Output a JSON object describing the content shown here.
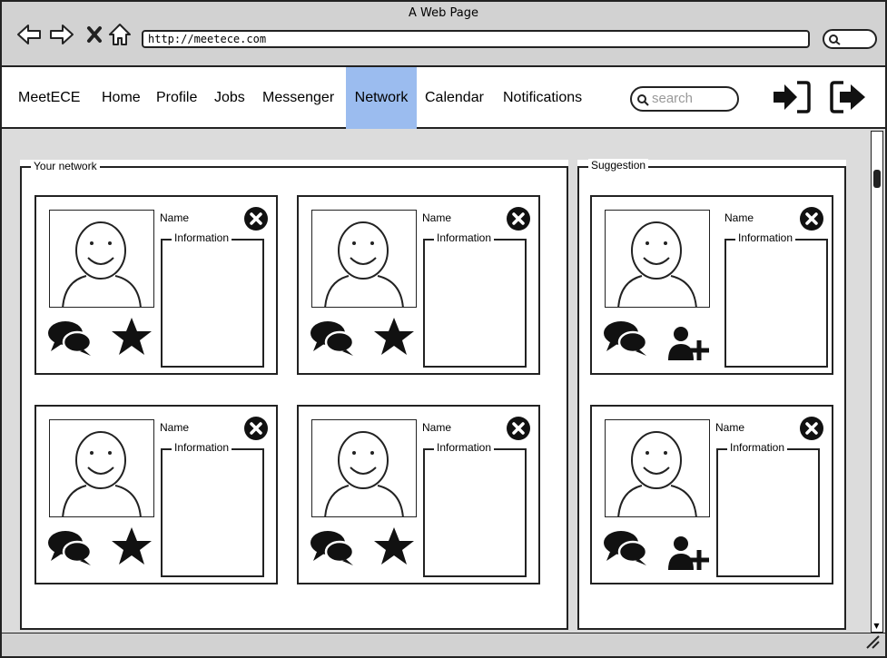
{
  "browser": {
    "title": "A Web Page",
    "url": "http://meetece.com"
  },
  "nav": {
    "brand": "MeetECE",
    "items": [
      {
        "label": "Home"
      },
      {
        "label": "Profile"
      },
      {
        "label": "Jobs"
      },
      {
        "label": "Messenger"
      },
      {
        "label": "Network",
        "active": true
      },
      {
        "label": "Calendar"
      },
      {
        "label": "Notifications"
      }
    ],
    "search_placeholder": "search",
    "active_color": "#9bbcef"
  },
  "network_panel": {
    "title": "Your network",
    "cards": [
      {
        "name": "Name",
        "info_label": "Information",
        "actions": [
          "chat-icon",
          "star-icon"
        ]
      },
      {
        "name": "Name",
        "info_label": "Information",
        "actions": [
          "chat-icon",
          "star-icon"
        ]
      },
      {
        "name": "Name",
        "info_label": "Information",
        "actions": [
          "chat-icon",
          "star-icon"
        ]
      },
      {
        "name": "Name",
        "info_label": "Information",
        "actions": [
          "chat-icon",
          "star-icon"
        ]
      }
    ]
  },
  "suggestion_panel": {
    "title": "Suggestion",
    "cards": [
      {
        "name": "Name",
        "info_label": "Information",
        "actions": [
          "chat-icon",
          "add-user-icon"
        ]
      },
      {
        "name": "Name",
        "info_label": "Information",
        "actions": [
          "chat-icon",
          "add-user-icon"
        ]
      }
    ]
  }
}
